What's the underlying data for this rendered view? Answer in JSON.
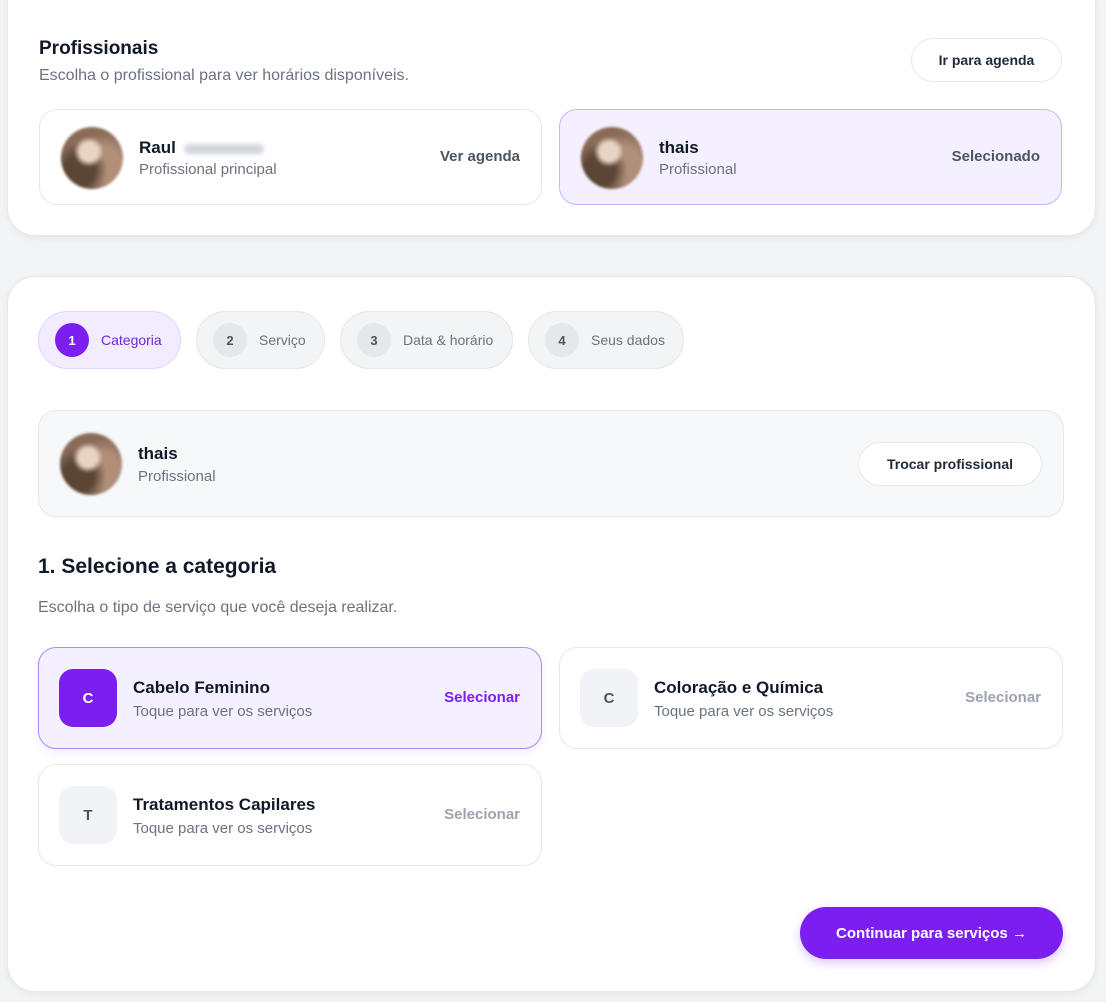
{
  "professionals": {
    "title": "Profissionais",
    "subtitle": "Escolha o profissional para ver horários disponíveis.",
    "go_to_agenda": "Ir para agenda",
    "items": [
      {
        "name": "Raul",
        "role": "Profissional principal",
        "action": "Ver agenda",
        "selected": false
      },
      {
        "name": "thais",
        "role": "Profissional",
        "action": "Selecionado",
        "selected": true
      }
    ]
  },
  "steps": [
    {
      "number": "1",
      "label": "Categoria",
      "active": true
    },
    {
      "number": "2",
      "label": "Serviço",
      "active": false
    },
    {
      "number": "3",
      "label": "Data & horário",
      "active": false
    },
    {
      "number": "4",
      "label": "Seus dados",
      "active": false
    }
  ],
  "current_professional": {
    "name": "thais",
    "role": "Profissional",
    "change_button": "Trocar profissional"
  },
  "category_section": {
    "title": "1. Selecione a categoria",
    "subtitle": "Escolha o tipo de serviço que você deseja realizar.",
    "items": [
      {
        "initial": "C",
        "name": "Cabelo Feminino",
        "hint": "Toque para ver os serviços",
        "action": "Selecionar",
        "selected": true
      },
      {
        "initial": "C",
        "name": "Coloração e Química",
        "hint": "Toque para ver os serviços",
        "action": "Selecionar",
        "selected": false
      },
      {
        "initial": "T",
        "name": "Tratamentos Capilares",
        "hint": "Toque para ver os serviços",
        "action": "Selecionar",
        "selected": false
      }
    ]
  },
  "continue_button": "Continuar para serviços →",
  "colors": {
    "accent": "#7c1ef0",
    "selected_bg": "#f5f0ff",
    "page_bg": "#f3f4f6"
  }
}
